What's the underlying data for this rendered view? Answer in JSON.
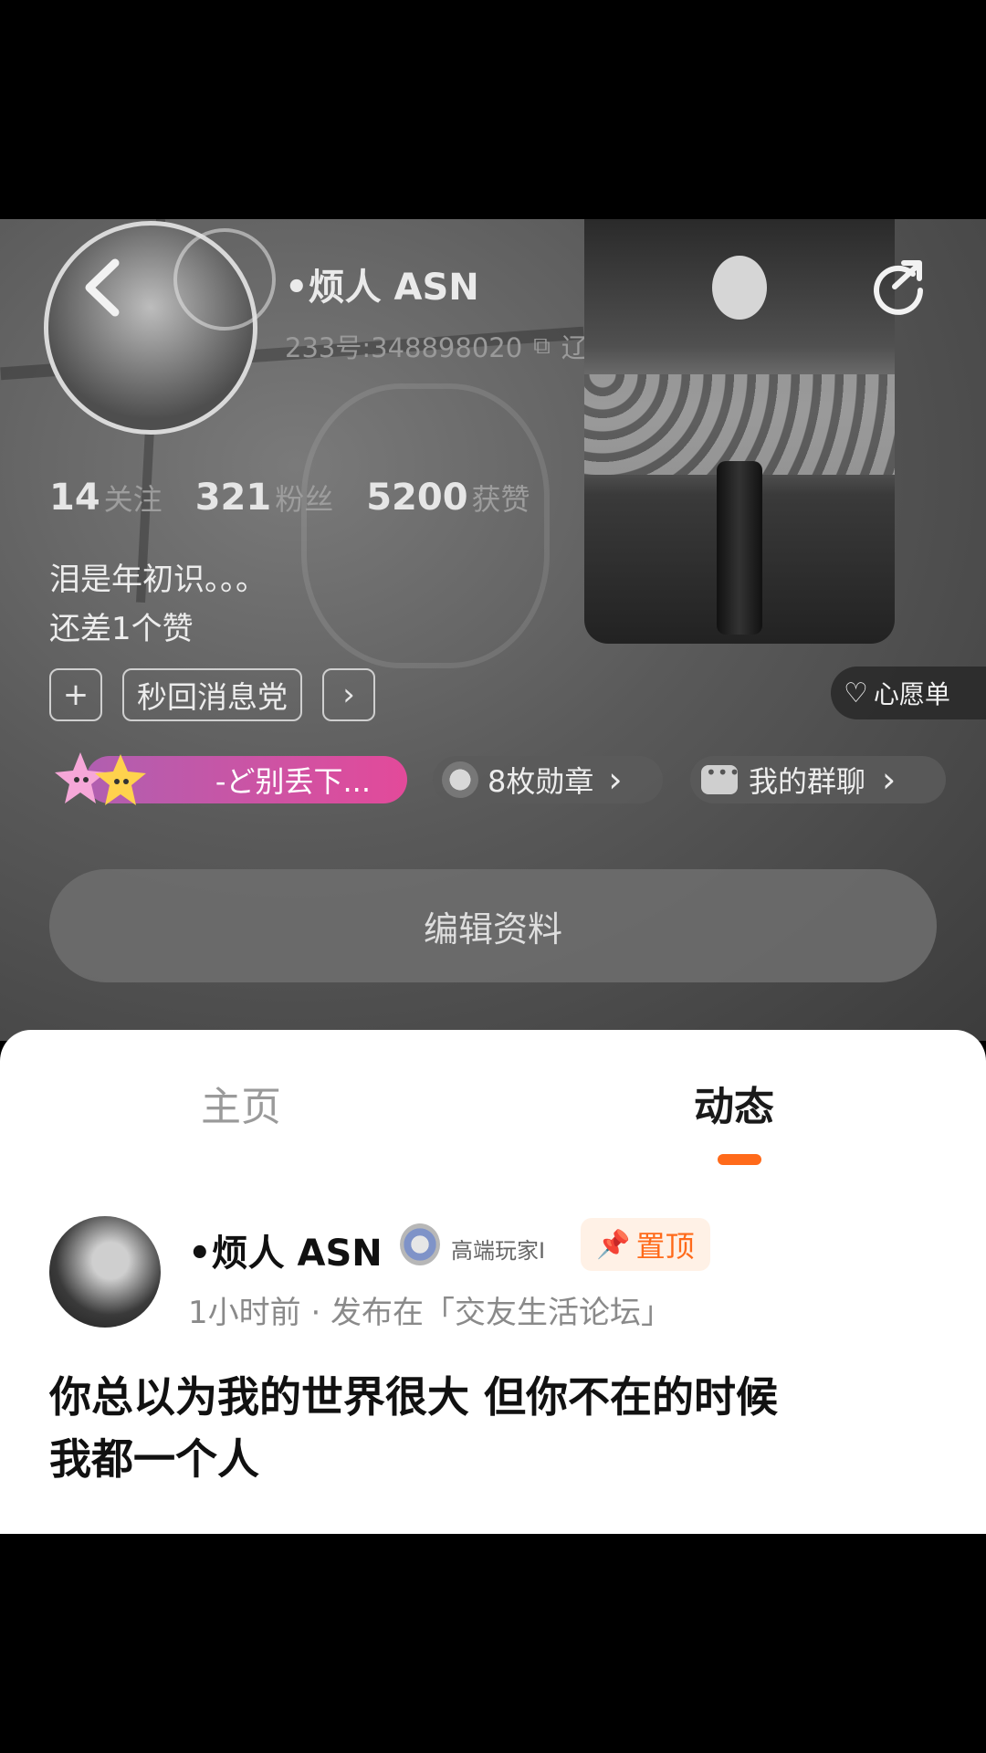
{
  "profile": {
    "nickname": "•烦人 ASN",
    "uid": "233号:348898020",
    "region": "辽宁",
    "stats": [
      {
        "num": "14",
        "label": "关注"
      },
      {
        "num": "321",
        "label": "粉丝"
      },
      {
        "num": "5200",
        "label": "获赞"
      }
    ],
    "bio_line1": "泪是年初识。。。",
    "bio_line2": "还差1个赞",
    "tag": "秒回消息党",
    "tag_plus": "+",
    "tag_arrow": "›",
    "wishlist": "心愿单",
    "title_chip": "-ど别丢下...",
    "medals": "8枚勋章",
    "groups": "我的群聊",
    "chevron": "›",
    "edit_button": "编辑资料"
  },
  "tabs": [
    {
      "label": "主页"
    },
    {
      "label": "动态"
    }
  ],
  "post": {
    "author": "•烦人 ASN",
    "badge": "高端玩家I",
    "pin": "置顶",
    "meta": "1小时前 · 发布在「交友生活论坛」",
    "body_line1": "你总以为我的世界很大 但你不在的时候",
    "body_line2": "我都一个人"
  },
  "colors": {
    "accent": "#ff6a1a",
    "title_chip_start": "#b05fb0",
    "title_chip_end": "#e34a9a"
  }
}
